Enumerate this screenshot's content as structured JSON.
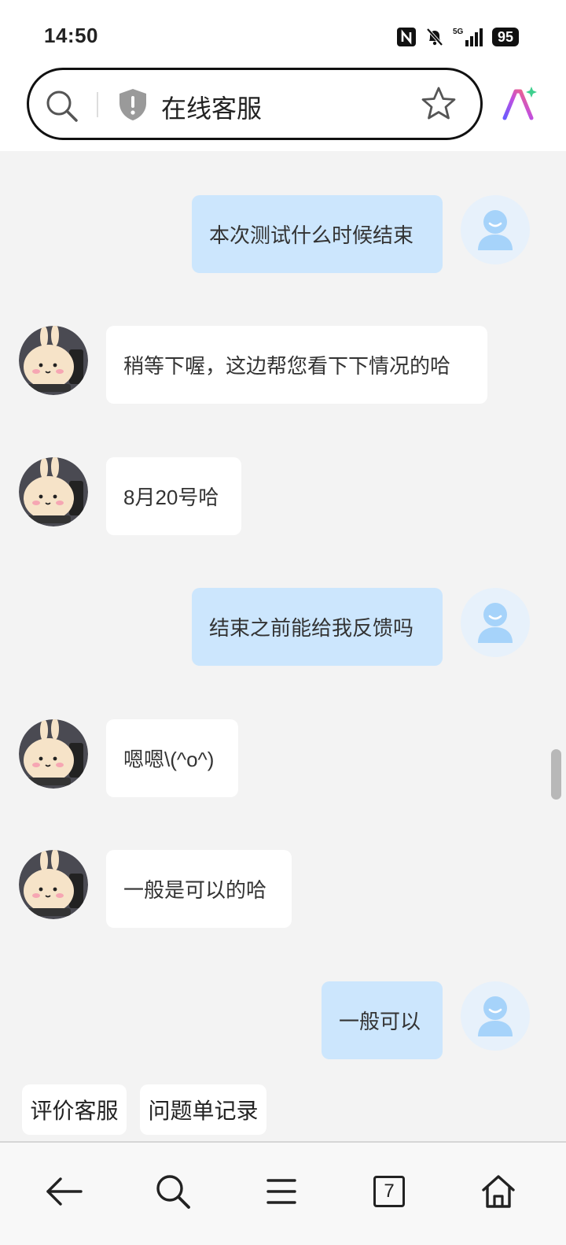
{
  "status_bar": {
    "time": "14:50",
    "icons": [
      "nfc-icon",
      "bell-muted-icon",
      "signal-5g-icon"
    ],
    "signal_label": "5G",
    "battery": "95"
  },
  "browser": {
    "page_title": "在线客服",
    "icons": [
      "search-icon",
      "shield-icon",
      "star-icon",
      "ai-assistant-icon"
    ]
  },
  "messages": [
    {
      "from": "user",
      "text": "本次测试什么时候结束"
    },
    {
      "from": "agent",
      "text": "稍等下喔，这边帮您看下下情况的哈"
    },
    {
      "from": "agent",
      "text": "8月20号哈"
    },
    {
      "from": "user",
      "text": "结束之前能给我反馈吗"
    },
    {
      "from": "agent",
      "text": "嗯嗯\\(^o^)"
    },
    {
      "from": "agent",
      "text": "一般是可以的哈"
    },
    {
      "from": "user",
      "text": "一般可以"
    }
  ],
  "quick_actions": [
    "评价客服",
    "问题单记录"
  ],
  "bottom_nav": {
    "items": [
      "back-icon",
      "search-icon",
      "menu-icon",
      "tabs-icon",
      "home-icon"
    ],
    "tab_count": "7"
  },
  "colors": {
    "user_bubble": "#cce6fd",
    "agent_bubble": "#ffffff",
    "chat_bg": "#f3f3f3"
  }
}
